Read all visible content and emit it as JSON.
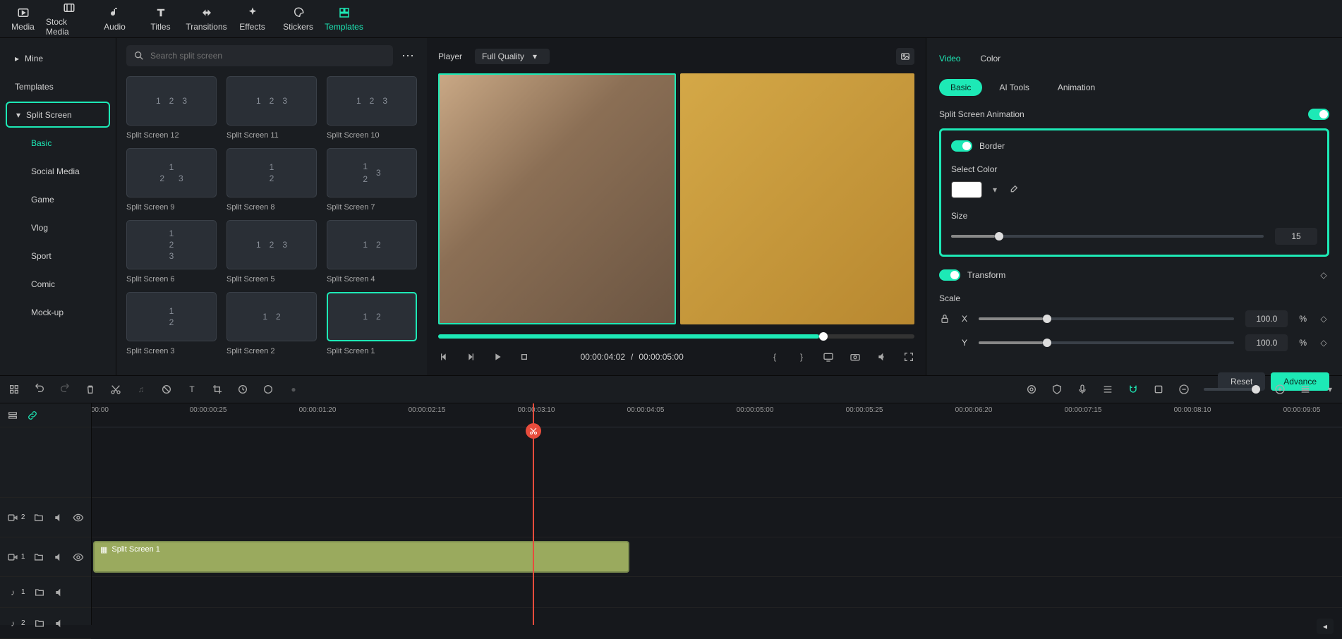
{
  "toolbar": {
    "items": [
      "Media",
      "Stock Media",
      "Audio",
      "Titles",
      "Transitions",
      "Effects",
      "Stickers",
      "Templates"
    ],
    "active": "Templates"
  },
  "sidebar": {
    "mine": "Mine",
    "templates": "Templates",
    "split_screen": "Split Screen",
    "subs": [
      "Basic",
      "Social Media",
      "Game",
      "Vlog",
      "Sport",
      "Comic",
      "Mock-up"
    ],
    "active_sub": "Basic"
  },
  "search": {
    "placeholder": "Search split screen"
  },
  "grid": {
    "items": [
      {
        "label": "Split Screen 12"
      },
      {
        "label": "Split Screen 11"
      },
      {
        "label": "Split Screen 10"
      },
      {
        "label": "Split Screen 9"
      },
      {
        "label": "Split Screen 8"
      },
      {
        "label": "Split Screen 7"
      },
      {
        "label": "Split Screen 6"
      },
      {
        "label": "Split Screen 5"
      },
      {
        "label": "Split Screen 4"
      },
      {
        "label": "Split Screen 3"
      },
      {
        "label": "Split Screen 2"
      },
      {
        "label": "Split Screen 1",
        "selected": true
      }
    ]
  },
  "player": {
    "title": "Player",
    "quality": "Full Quality",
    "current": "00:00:04:02",
    "sep": "/",
    "total": "00:00:05:00"
  },
  "inspector": {
    "tabs": [
      "Video",
      "Color"
    ],
    "active_tab": "Video",
    "subtabs": [
      "Basic",
      "AI Tools",
      "Animation"
    ],
    "active_subtab": "Basic",
    "anim_label": "Split Screen Animation",
    "border_label": "Border",
    "select_color_label": "Select Color",
    "size_label": "Size",
    "size_value": "15",
    "transform_label": "Transform",
    "scale_label": "Scale",
    "x_label": "X",
    "y_label": "Y",
    "x_value": "100.0",
    "y_value": "100.0",
    "pct": "%",
    "reset": "Reset",
    "advance": "Advance"
  },
  "timeline": {
    "ruler": [
      ":00:00",
      "00:00:00:25",
      "00:00:01:20",
      "00:00:02:15",
      "00:00:03:10",
      "00:00:04:05",
      "00:00:05:00",
      "00:00:05:25",
      "00:00:06:20",
      "00:00:07:15",
      "00:00:08:10",
      "00:00:09:05"
    ],
    "playhead_time": "00:00:03:10",
    "clip_label": "Split Screen 1",
    "tracks": [
      {
        "icon": "video",
        "idx": "2"
      },
      {
        "icon": "video",
        "idx": "1"
      },
      {
        "icon": "audio",
        "idx": "1"
      },
      {
        "icon": "audio",
        "idx": "2"
      }
    ]
  }
}
